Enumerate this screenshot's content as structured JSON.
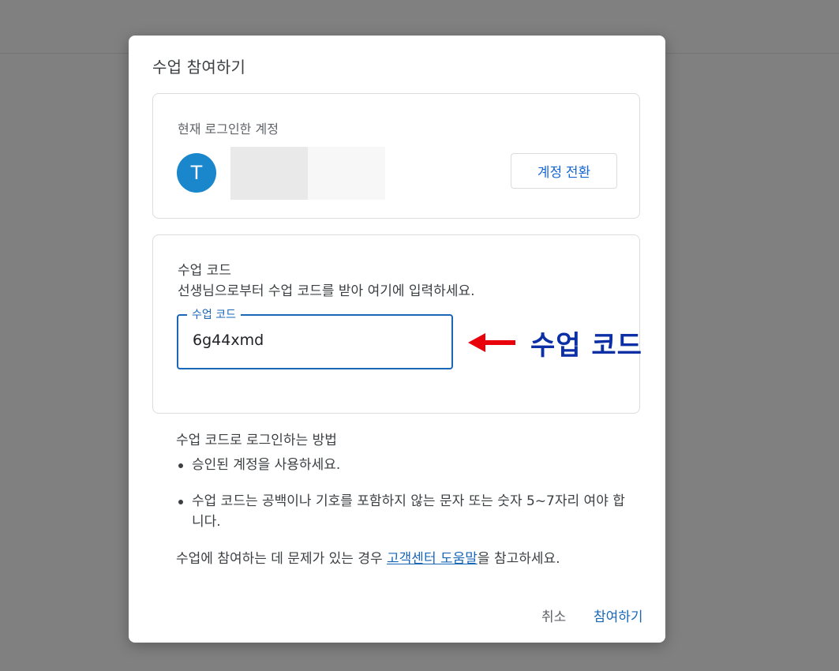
{
  "dialog": {
    "title": "수업 참여하기"
  },
  "account": {
    "heading": "현재 로그인한 계정",
    "avatar_letter": "T",
    "avatar_color": "#1a86cc",
    "switch_label": "계정 전환"
  },
  "class_code": {
    "heading": "수업 코드",
    "description": "선생님으로부터 수업 코드를 받아 여기에 입력하세요.",
    "field_label": "수업 코드",
    "value": "6g44xmd"
  },
  "annotation": {
    "label": "수업 코드",
    "arrow_color": "#e8000b",
    "label_color": "#0c2fa5"
  },
  "howto": {
    "title": "수업 코드로 로그인하는 방법",
    "bullets": [
      "승인된 계정을 사용하세요.",
      "수업 코드는 공백이나 기호를 포함하지 않는 문자 또는 숫자 5~7자리 여야 합니다."
    ]
  },
  "help": {
    "prefix": "수업에 참여하는 데 문제가 있는 경우 ",
    "link_text": "고객센터 도움말",
    "suffix": "을 참고하세요."
  },
  "actions": {
    "cancel_label": "취소",
    "join_label": "참여하기"
  }
}
